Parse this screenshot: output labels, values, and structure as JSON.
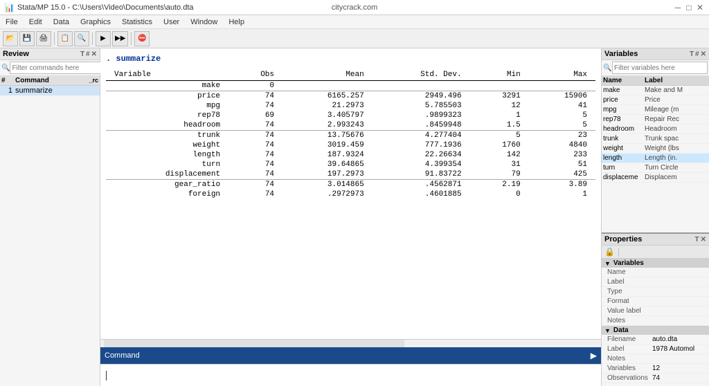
{
  "titlebar": {
    "title": "Stata/MP 15.0 - C:\\Users\\Video\\Documents\\auto.dta",
    "website": "citycrack.com",
    "min": "─",
    "max": "□",
    "close": "✕"
  },
  "menubar": {
    "items": [
      "File",
      "Edit",
      "Data",
      "Graphics",
      "Statistics",
      "User",
      "Window",
      "Help"
    ]
  },
  "review": {
    "title": "Review",
    "filter_placeholder": "Filter commands here",
    "col_hash": "#",
    "col_command": "Command",
    "col_rc": "_rc",
    "rows": [
      {
        "num": "1",
        "cmd": "summarize"
      }
    ]
  },
  "output": {
    "command": "summarize",
    "table": {
      "headers": [
        "Variable",
        "Obs",
        "Mean",
        "Std. Dev.",
        "Min",
        "Max"
      ],
      "sections": [
        {
          "rows": [
            {
              "variable": "make",
              "obs": "0",
              "mean": "",
              "stddev": "",
              "min": "",
              "max": ""
            }
          ]
        },
        {
          "rows": [
            {
              "variable": "price",
              "obs": "74",
              "mean": "6165.257",
              "stddev": "2949.496",
              "min": "3291",
              "max": "15906"
            },
            {
              "variable": "mpg",
              "obs": "74",
              "mean": "21.2973",
              "stddev": "5.785503",
              "min": "12",
              "max": "41"
            },
            {
              "variable": "rep78",
              "obs": "69",
              "mean": "3.405797",
              "stddev": ".9899323",
              "min": "1",
              "max": "5"
            },
            {
              "variable": "headroom",
              "obs": "74",
              "mean": "2.993243",
              "stddev": ".8459948",
              "min": "1.5",
              "max": "5"
            }
          ]
        },
        {
          "rows": [
            {
              "variable": "trunk",
              "obs": "74",
              "mean": "13.75676",
              "stddev": "4.277404",
              "min": "5",
              "max": "23"
            },
            {
              "variable": "weight",
              "obs": "74",
              "mean": "3019.459",
              "stddev": "777.1936",
              "min": "1760",
              "max": "4840"
            },
            {
              "variable": "length",
              "obs": "74",
              "mean": "187.9324",
              "stddev": "22.26634",
              "min": "142",
              "max": "233"
            },
            {
              "variable": "turn",
              "obs": "74",
              "mean": "39.64865",
              "stddev": "4.399354",
              "min": "31",
              "max": "51"
            },
            {
              "variable": "displacement",
              "obs": "74",
              "mean": "197.2973",
              "stddev": "91.83722",
              "min": "79",
              "max": "425"
            }
          ]
        },
        {
          "rows": [
            {
              "variable": "gear_ratio",
              "obs": "74",
              "mean": "3.014865",
              "stddev": ".4562871",
              "min": "2.19",
              "max": "3.89"
            },
            {
              "variable": "foreign",
              "obs": "74",
              "mean": ".2972973",
              "stddev": ".4601885",
              "min": "0",
              "max": "1"
            }
          ]
        }
      ]
    }
  },
  "command": {
    "label": "Command",
    "placeholder": ""
  },
  "variables": {
    "title": "Variables",
    "filter_placeholder": "Filter variables here",
    "col_name": "Name",
    "col_label": "Label",
    "rows": [
      {
        "name": "make",
        "label": "Make and M"
      },
      {
        "name": "price",
        "label": "Price"
      },
      {
        "name": "mpg",
        "label": "Mileage (m"
      },
      {
        "name": "rep78",
        "label": "Repair Rec"
      },
      {
        "name": "headroom",
        "label": "Headroom"
      },
      {
        "name": "trunk",
        "label": "Trunk spac"
      },
      {
        "name": "weight",
        "label": "Weight (lbs"
      },
      {
        "name": "length",
        "label": "Length (in."
      },
      {
        "name": "turn",
        "label": "Turn Circle"
      },
      {
        "name": "displaceme",
        "label": "Displacem"
      }
    ]
  },
  "properties": {
    "title": "Properties",
    "variables_section": {
      "label": "Variables",
      "rows": [
        {
          "key": "Name",
          "val": ""
        },
        {
          "key": "Label",
          "val": ""
        },
        {
          "key": "Type",
          "val": ""
        },
        {
          "key": "Format",
          "val": ""
        },
        {
          "key": "Value label",
          "val": ""
        },
        {
          "key": "Notes",
          "val": ""
        }
      ]
    },
    "data_section": {
      "label": "Data",
      "rows": [
        {
          "key": "Filename",
          "val": "auto.dta"
        },
        {
          "key": "Label",
          "val": "1978 Automol"
        },
        {
          "key": "Notes",
          "val": ""
        },
        {
          "key": "Variables",
          "val": "12"
        },
        {
          "key": "Observations",
          "val": "74"
        }
      ]
    }
  }
}
